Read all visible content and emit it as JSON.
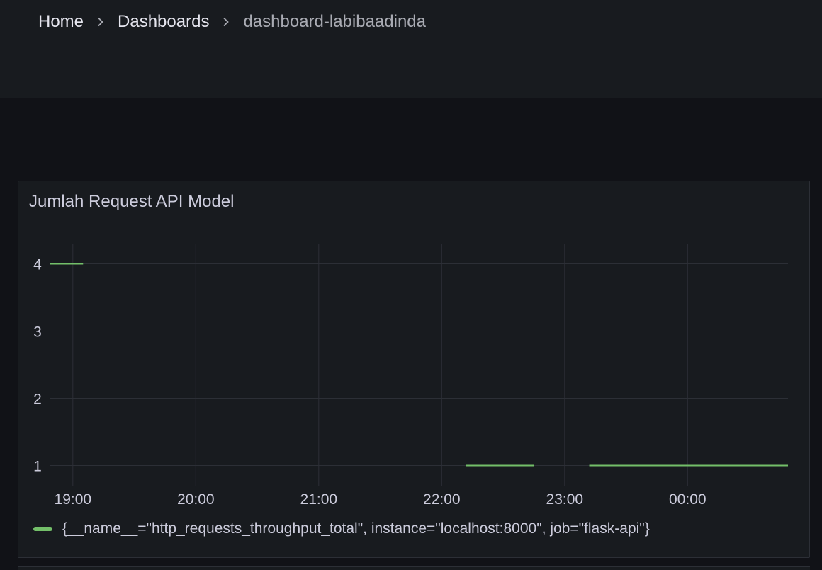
{
  "breadcrumb": {
    "items": [
      {
        "label": "Home"
      },
      {
        "label": "Dashboards"
      },
      {
        "label": "dashboard-labibaadinda"
      }
    ]
  },
  "panel": {
    "title": "Jumlah Request API Model"
  },
  "colors": {
    "series": "#73bf69",
    "grid": "#2c2f36",
    "tick": "#ccccdc"
  },
  "chart_data": {
    "type": "line",
    "title": "Jumlah Request API Model",
    "xlabel": "",
    "ylabel": "",
    "x_ticks": [
      "19:00",
      "20:00",
      "21:00",
      "22:00",
      "23:00",
      "00:00"
    ],
    "y_ticks": [
      1,
      2,
      3,
      4
    ],
    "xlim": [
      "18:49",
      "00:49"
    ],
    "ylim": [
      0.7,
      4.3
    ],
    "grid": true,
    "legend": "bottom-left",
    "series": [
      {
        "name": "{__name__=\"http_requests_throughput_total\", instance=\"localhost:8000\", job=\"flask-api\"}",
        "segments": [
          [
            {
              "x": "18:49",
              "y": 4
            },
            {
              "x": "19:05",
              "y": 4
            }
          ],
          [
            {
              "x": "22:12",
              "y": 1
            },
            {
              "x": "22:45",
              "y": 1
            }
          ],
          [
            {
              "x": "23:12",
              "y": 1
            },
            {
              "x": "00:49",
              "y": 1
            }
          ]
        ]
      }
    ]
  }
}
